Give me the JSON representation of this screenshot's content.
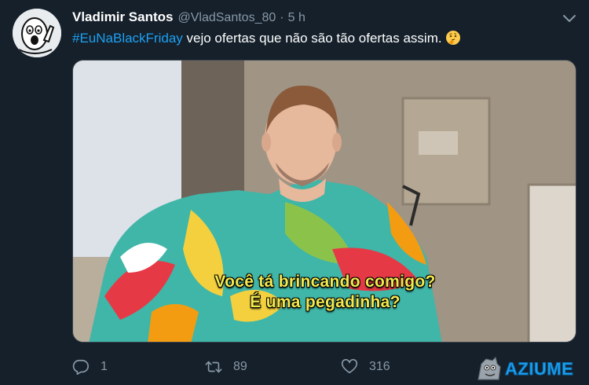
{
  "tweet": {
    "display_name": "Vladimir Santos",
    "handle": "@VladSantos_80",
    "separator": "·",
    "time": "5 h",
    "hashtag": "#EuNaBlackFriday",
    "text": " vejo ofertas que não são tão ofertas assim.",
    "emoji": "thinking-face-emoji"
  },
  "media": {
    "subtitle_line1": "Você tá brincando comigo?",
    "subtitle_line2": "É uma pegadinha?"
  },
  "actions": {
    "replies": "1",
    "retweets": "89",
    "likes": "316"
  },
  "watermark": {
    "text": "AZIUME"
  },
  "colors": {
    "background": "#15202b",
    "accent": "#1da1f2",
    "muted": "#8899a6",
    "subtitle": "#f2e94e"
  }
}
